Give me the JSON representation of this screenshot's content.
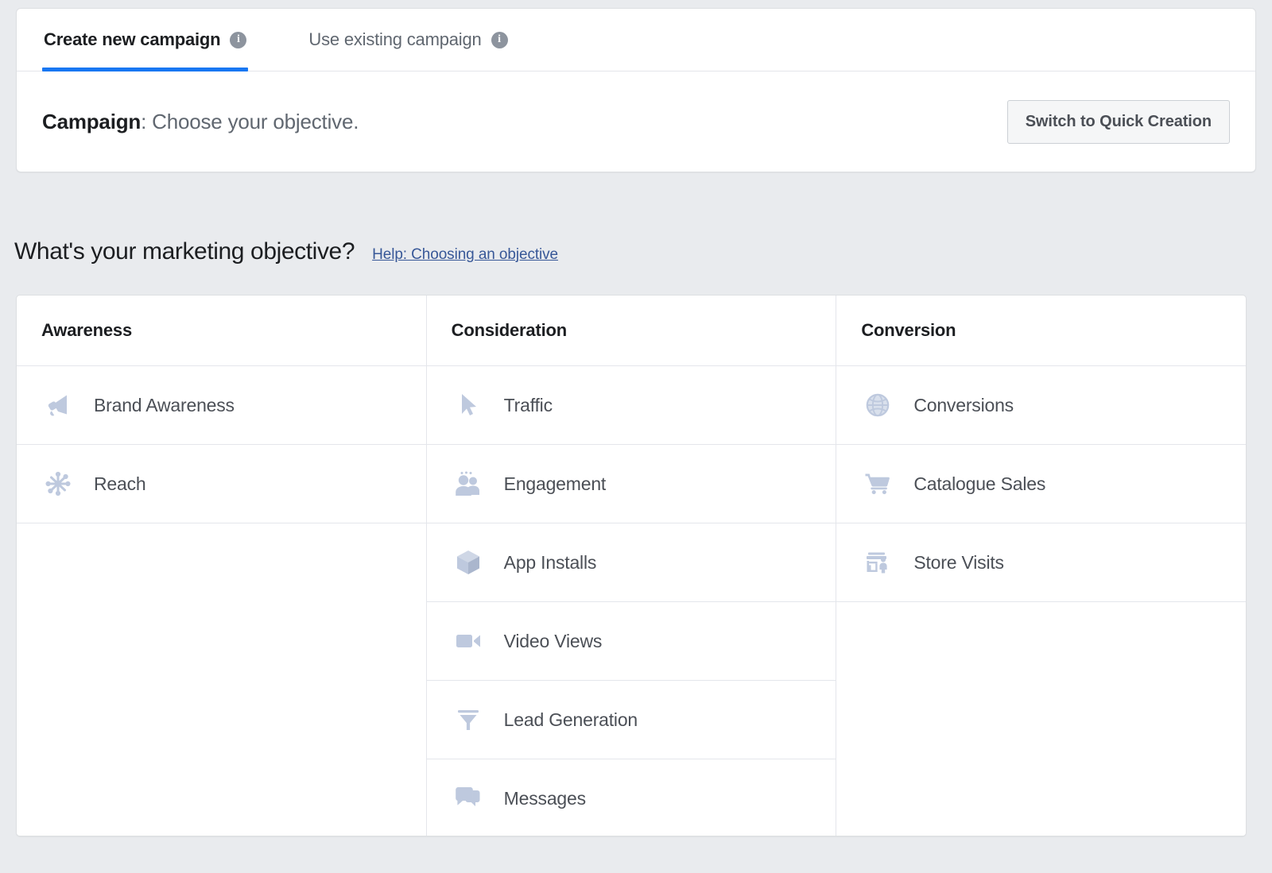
{
  "tabs": [
    {
      "label": "Create new campaign",
      "active": true,
      "info_icon": "info-icon",
      "info_glyph": "i"
    },
    {
      "label": "Use existing campaign",
      "active": false,
      "info_icon": "info-icon",
      "info_glyph": "i"
    }
  ],
  "campaign_header": {
    "label_bold": "Campaign",
    "label_rest": ": Choose your objective.",
    "quick_creation_button": "Switch to Quick Creation"
  },
  "objective_section": {
    "title": "What's your marketing objective?",
    "help_link": "Help: Choosing an objective"
  },
  "columns": [
    {
      "header": "Awareness",
      "items": [
        {
          "label": "Brand Awareness",
          "icon": "megaphone-icon"
        },
        {
          "label": "Reach",
          "icon": "reach-hub-icon"
        }
      ]
    },
    {
      "header": "Consideration",
      "items": [
        {
          "label": "Traffic",
          "icon": "cursor-arrow-icon"
        },
        {
          "label": "Engagement",
          "icon": "people-group-icon"
        },
        {
          "label": "App Installs",
          "icon": "cube-icon"
        },
        {
          "label": "Video Views",
          "icon": "video-camera-icon"
        },
        {
          "label": "Lead Generation",
          "icon": "funnel-icon"
        },
        {
          "label": "Messages",
          "icon": "speech-bubbles-icon"
        }
      ]
    },
    {
      "header": "Conversion",
      "items": [
        {
          "label": "Conversions",
          "icon": "globe-icon"
        },
        {
          "label": "Catalogue Sales",
          "icon": "shopping-cart-icon"
        },
        {
          "label": "Store Visits",
          "icon": "storefront-person-icon"
        }
      ]
    }
  ],
  "colors": {
    "page_background": "#e9ebee",
    "card_background": "#ffffff",
    "active_tab_underline": "#1877f2",
    "link": "#385898",
    "icon_tint": "#bec9de",
    "border": "#e4e6eb",
    "primary_text": "#1c1e21",
    "secondary_text": "#606770"
  }
}
